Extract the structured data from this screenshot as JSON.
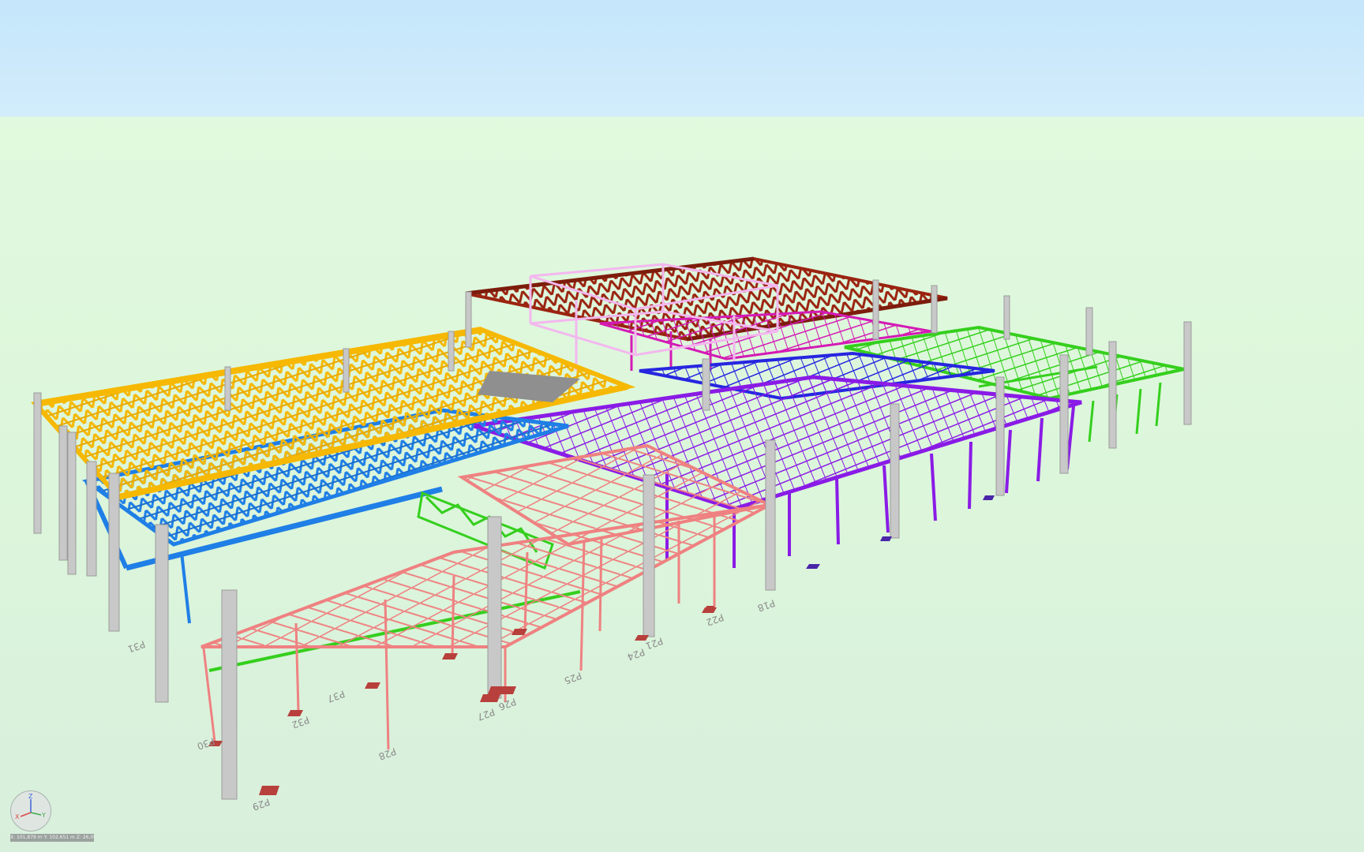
{
  "app": {
    "view": "3D structural model",
    "coordinate_readout": "X: 101,879 m  Y: 102,651 m  Z: 26,096 m"
  },
  "colors": {
    "sky": "#c5e6fb",
    "ground": "#dcf6db",
    "orange_module": "#f6b800",
    "blue_module": "#1f7fe6",
    "purple_module": "#8a1be6",
    "dark_blue_module": "#2626e0",
    "green_module": "#35cf1d",
    "brown_module": "#9a2410",
    "magenta_module": "#d41ab5",
    "pink_frame": "#f3b7ef",
    "salmon_module": "#ef8181",
    "concrete_column": "#c8c8c8",
    "footing": "#b8403c"
  },
  "axis_gizmo": {
    "x": "X",
    "y": "Y",
    "z": "Z"
  },
  "pillar_labels": [
    {
      "id": "p29",
      "text": "P29"
    },
    {
      "id": "p28",
      "text": "P28"
    },
    {
      "id": "p30",
      "text": "P30"
    },
    {
      "id": "p27",
      "text": "P27"
    },
    {
      "id": "p26",
      "text": "P26"
    },
    {
      "id": "p25",
      "text": "P25"
    },
    {
      "id": "p24",
      "text": "P24"
    },
    {
      "id": "p21",
      "text": "P21"
    },
    {
      "id": "p22",
      "text": "P22"
    },
    {
      "id": "p31",
      "text": "P31"
    },
    {
      "id": "p37",
      "text": "P37"
    },
    {
      "id": "p32",
      "text": "P32"
    },
    {
      "id": "p18",
      "text": "P18"
    }
  ]
}
